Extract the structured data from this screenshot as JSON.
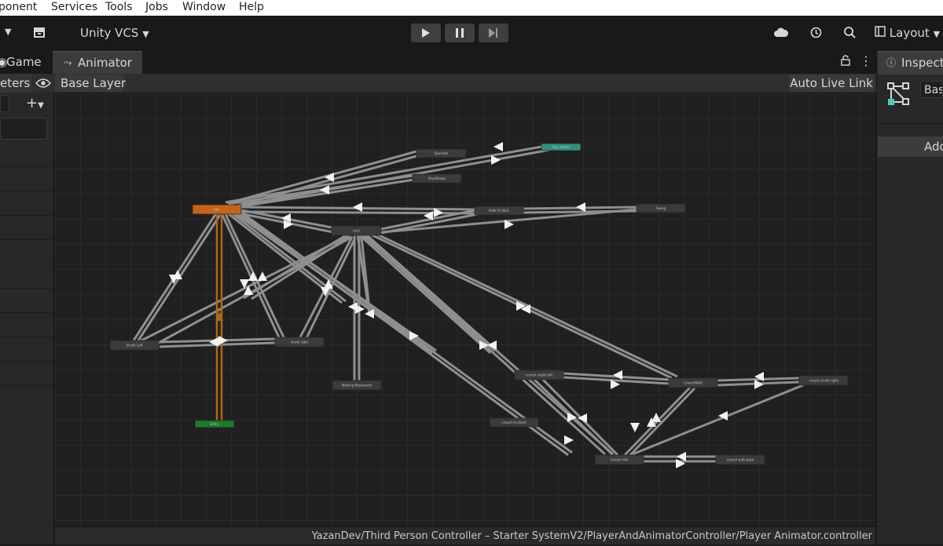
{
  "menu": {
    "items": [
      "ponent",
      "Services",
      "Tools",
      "Jobs",
      "Window",
      "Help"
    ]
  },
  "toolbar": {
    "vcs_label": "Unity VCS",
    "layout_label": "Layout"
  },
  "tabs": {
    "game": "Game",
    "animator": "Animator",
    "inspector": "Inspect"
  },
  "animator": {
    "parameters_tab": "eters",
    "breadcrumb": "Base Layer",
    "auto_live_link": "Auto Live Link",
    "path": "YazanDev/Third Person Controller – Starter SystemV2/PlayerAndAnimatorController/Player Animator.controller",
    "nodes": {
      "spectate": "Spectate",
      "hey_emote": "Hey Emote",
      "shaked": "ShedShake",
      "idle": "Idle",
      "run_to_idle": "RUN TO IDLE",
      "swing": "Swing",
      "jump": "run1",
      "strafe_left": "Strafe Left",
      "strafe_right": "strafe right",
      "walking_back": "Walking Backwards",
      "entry": "Entry",
      "crouch_strafe_left": "crouch strafe left",
      "crouch_walk": "CrouchWalk",
      "crouch_strafe_right": "crouch strafe right",
      "crouch_to_stand": "crouch to stand",
      "crouch_idle": "Crouch Idle",
      "crouch_walk_back": "crouch walk back"
    }
  },
  "inspector": {
    "name_field": "Bas",
    "add_button": "Add"
  },
  "colors": {
    "default_node": "#3b3b3b",
    "default_state": "#c4641a",
    "entry": "#1d7a2c",
    "any_state": "#2f8f80"
  }
}
